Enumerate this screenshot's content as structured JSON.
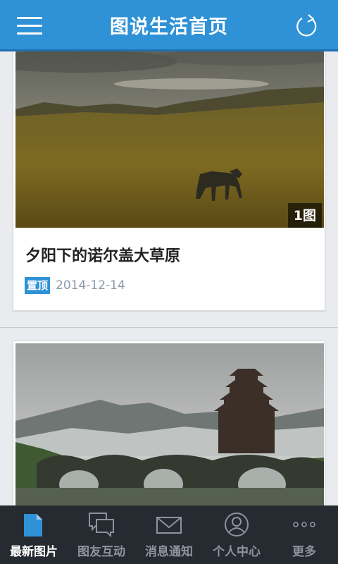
{
  "header": {
    "title": "图说生活首页",
    "menu_icon": "hamburger-menu-icon",
    "refresh_icon": "refresh-icon",
    "color": "#2f92d6"
  },
  "posts": [
    {
      "title": "夕阳下的诺尔盖大草原",
      "photo_count": "1图",
      "pinned_label": "置顶",
      "date": "2014-12-14",
      "image": "grassland-horse-photo"
    },
    {
      "image": "misty-mountain-pagoda-bridge-photo"
    }
  ],
  "tabs": [
    {
      "label": "最新图片",
      "icon": "document-icon",
      "active": true
    },
    {
      "label": "图友互动",
      "icon": "chat-bubbles-icon",
      "active": false
    },
    {
      "label": "消息通知",
      "icon": "envelope-icon",
      "active": false
    },
    {
      "label": "个人中心",
      "icon": "user-icon",
      "active": false
    },
    {
      "label": "更多",
      "icon": "more-dots-icon",
      "active": false
    }
  ],
  "colors": {
    "accent": "#2f92d6",
    "tabbar": "#262b31",
    "active_tab": "#2f92d6"
  }
}
